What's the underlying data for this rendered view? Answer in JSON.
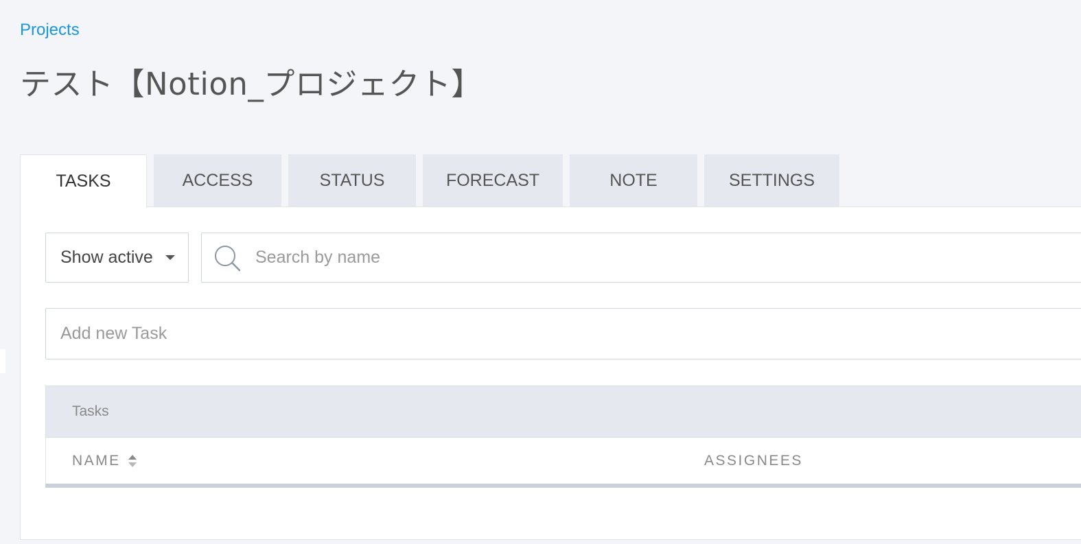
{
  "breadcrumb": {
    "label": "Projects"
  },
  "page": {
    "title": "テスト【Notion_プロジェクト】"
  },
  "tabs": [
    {
      "label": "TASKS",
      "active": true
    },
    {
      "label": "ACCESS",
      "active": false
    },
    {
      "label": "STATUS",
      "active": false
    },
    {
      "label": "FORECAST",
      "active": false
    },
    {
      "label": "NOTE",
      "active": false
    },
    {
      "label": "SETTINGS",
      "active": false
    }
  ],
  "filter": {
    "selected": "Show active",
    "icon": "chevron-down-icon"
  },
  "search": {
    "placeholder": "Search by name",
    "value": "",
    "icon": "search-icon"
  },
  "add_task": {
    "placeholder": "Add new Task",
    "value": ""
  },
  "table": {
    "caption": "Tasks",
    "columns": [
      {
        "label": "NAME",
        "sortable": true
      },
      {
        "label": "ASSIGNEES",
        "sortable": false
      }
    ],
    "rows": []
  },
  "colors": {
    "accent": "#1a95e0",
    "background": "#f3f5f9",
    "tab_inactive": "#e5e9ef",
    "panel": "#ffffff"
  }
}
